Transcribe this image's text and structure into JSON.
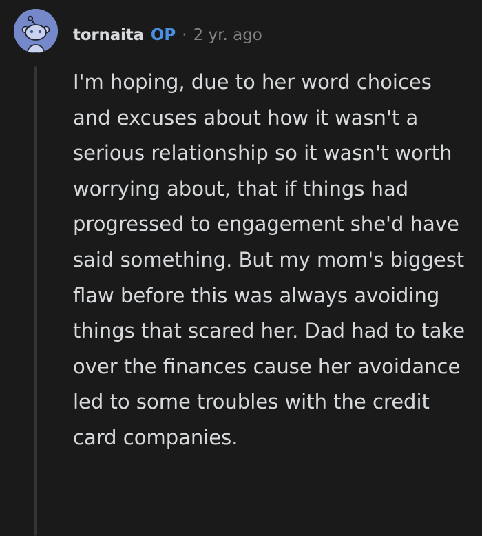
{
  "comment": {
    "author": "tornaita",
    "badge": "OP",
    "separator": "·",
    "timestamp": "2 yr. ago",
    "avatar_icon": "snoo-avatar-icon",
    "avatar_color": "#7588c9",
    "badge_color": "#4a8fe0",
    "body": "I'm hoping, due to her word choices and excuses about how it wasn't a serious relationship so it wasn't worth worrying about, that if things had progressed to engagement she'd have said something. But my mom's biggest flaw before this was always avoiding things that scared her. Dad had to take over the finances cause her avoidance led to some troubles with the credit card companies."
  }
}
